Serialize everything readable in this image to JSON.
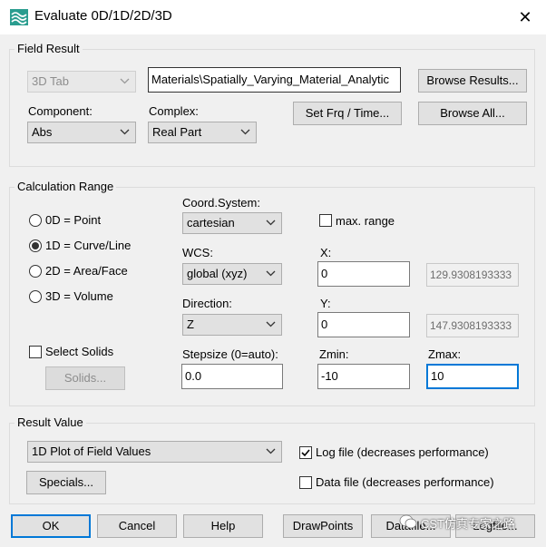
{
  "window": {
    "title": "Evaluate 0D/1D/2D/3D",
    "close_glyph": "✕"
  },
  "field_result": {
    "legend": "Field Result",
    "tab_select": "3D Tab",
    "path_value": "Materials\\Spatially_Varying_Material_Analytic",
    "browse_results": "Browse Results...",
    "component_label": "Component:",
    "component_value": "Abs",
    "complex_label": "Complex:",
    "complex_value": "Real Part",
    "set_frq_time": "Set Frq / Time...",
    "browse_all": "Browse All..."
  },
  "calc_range": {
    "legend": "Calculation Range",
    "radios": [
      {
        "label": "0D = Point",
        "checked": false
      },
      {
        "label": "1D = Curve/Line",
        "checked": true
      },
      {
        "label": "2D = Area/Face",
        "checked": false
      },
      {
        "label": "3D = Volume",
        "checked": false
      }
    ],
    "select_solids_label": "Select Solids",
    "solids_button": "Solids...",
    "coord_label": "Coord.System:",
    "coord_value": "cartesian",
    "max_range_label": "max. range",
    "wcs_label": "WCS:",
    "wcs_value": "global (xyz)",
    "x_label": "X:",
    "x_value": "0",
    "x_max": "129.9308193333",
    "direction_label": "Direction:",
    "direction_value": "Z",
    "y_label": "Y:",
    "y_value": "0",
    "y_max": "147.9308193333",
    "stepsize_label": "Stepsize (0=auto):",
    "stepsize_value": "0.0",
    "zmin_label": "Zmin:",
    "zmin_value": "-10",
    "zmax_label": "Zmax:",
    "zmax_value": "10"
  },
  "result_value": {
    "legend": "Result Value",
    "plot_value": "1D Plot of Field Values",
    "log_file_label": "Log file (decreases performance)",
    "log_file_checked": true,
    "data_file_label": "Data file (decreases performance)",
    "data_file_checked": false,
    "specials": "Specials..."
  },
  "footer": {
    "ok": "OK",
    "cancel": "Cancel",
    "help": "Help",
    "drawpoints": "DrawPoints",
    "datafile": "Datafile...",
    "logfile": "Logfile..."
  },
  "watermark": "CST仿真专家之路"
}
